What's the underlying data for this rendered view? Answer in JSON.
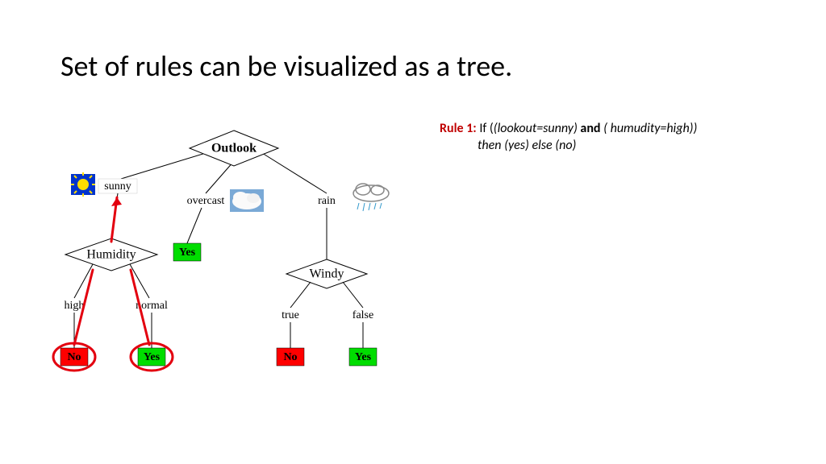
{
  "title": "Set of rules can be visualized as a tree.",
  "rule": {
    "label": "Rule 1:",
    "if": "If (",
    "cond1": "(lookout=sunny)",
    "and": "and",
    "cond2": "( humudity=high))",
    "then": "then (yes) else (no)"
  },
  "tree": {
    "root": "Outlook",
    "branches": {
      "sunny": "sunny",
      "overcast": "overcast",
      "rain": "rain"
    },
    "humidity": "Humidity",
    "humidity_branches": {
      "high": "high",
      "normal": "normal"
    },
    "windy": "Windy",
    "windy_branches": {
      "true": "true",
      "false": "false"
    },
    "yes": "Yes",
    "no": "No"
  }
}
